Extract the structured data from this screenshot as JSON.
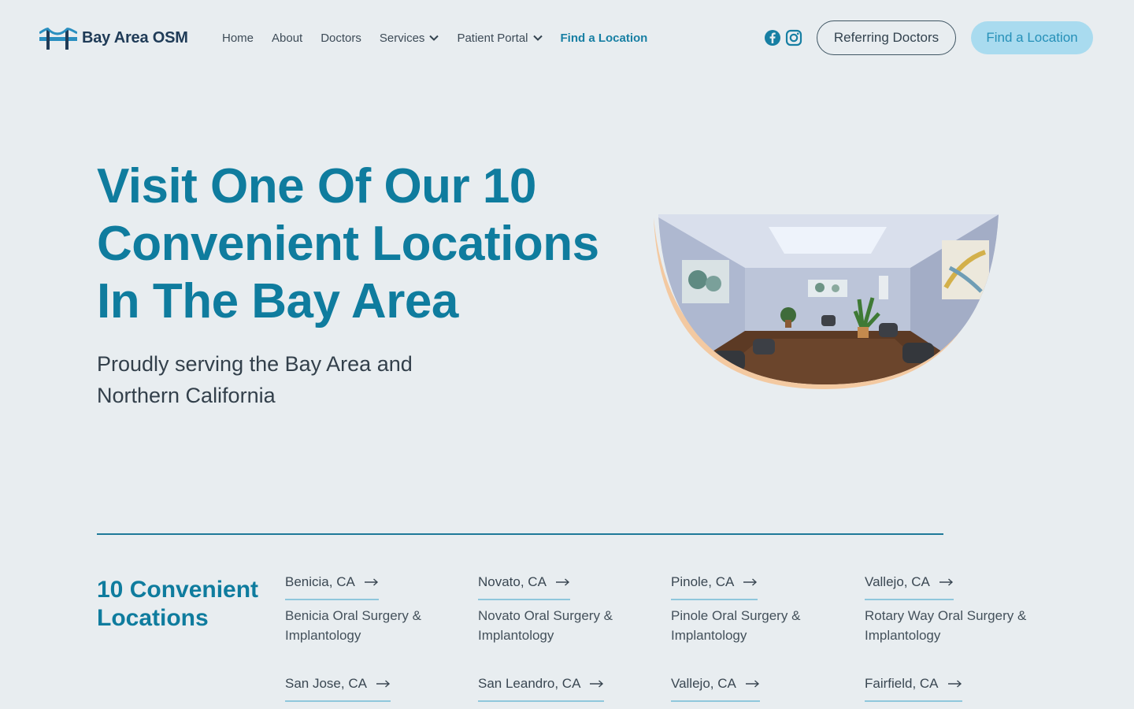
{
  "brand": {
    "name": "Bay Area OSM",
    "logo_icon": "bridge-logo-icon",
    "color": "#177fa3"
  },
  "nav": {
    "items": [
      {
        "label": "Home"
      },
      {
        "label": "About"
      },
      {
        "label": "Doctors"
      },
      {
        "label": "Services"
      },
      {
        "label": "Patient Portal"
      },
      {
        "label": "Find a Location"
      }
    ]
  },
  "social": {
    "facebook_icon": "facebook-icon",
    "instagram_icon": "instagram-icon"
  },
  "header_buttons": {
    "referring": "Referring Doctors",
    "find": "Find a Location"
  },
  "hero": {
    "title": "Visit One Of Our 10 Convenient Locations In The Bay Area",
    "subtitle": "Proudly serving the Bay Area and Northern California",
    "image": "waiting-room-photo"
  },
  "locations": {
    "heading": "10 Convenient Locations",
    "items": [
      {
        "city": "Benicia, CA",
        "practice": "Benicia Oral Surgery & Implantology"
      },
      {
        "city": "Novato, CA",
        "practice": "Novato Oral Surgery & Implantology"
      },
      {
        "city": "Pinole, CA",
        "practice": "Pinole Oral Surgery & Implantology"
      },
      {
        "city": "Vallejo, CA",
        "practice": "Rotary Way Oral Surgery & Implantology"
      },
      {
        "city": "San Jose, CA",
        "practice": ""
      },
      {
        "city": "San Leandro, CA",
        "practice": ""
      },
      {
        "city": "Vallejo, CA",
        "practice": ""
      },
      {
        "city": "Fairfield, CA",
        "practice": ""
      }
    ]
  },
  "colors": {
    "background": "#e8edf0",
    "primary": "#0f7c9e",
    "button_fill": "#a9dbef",
    "accent_underline": "#8fc7dc",
    "image_shadow": "#f3c9a1"
  }
}
